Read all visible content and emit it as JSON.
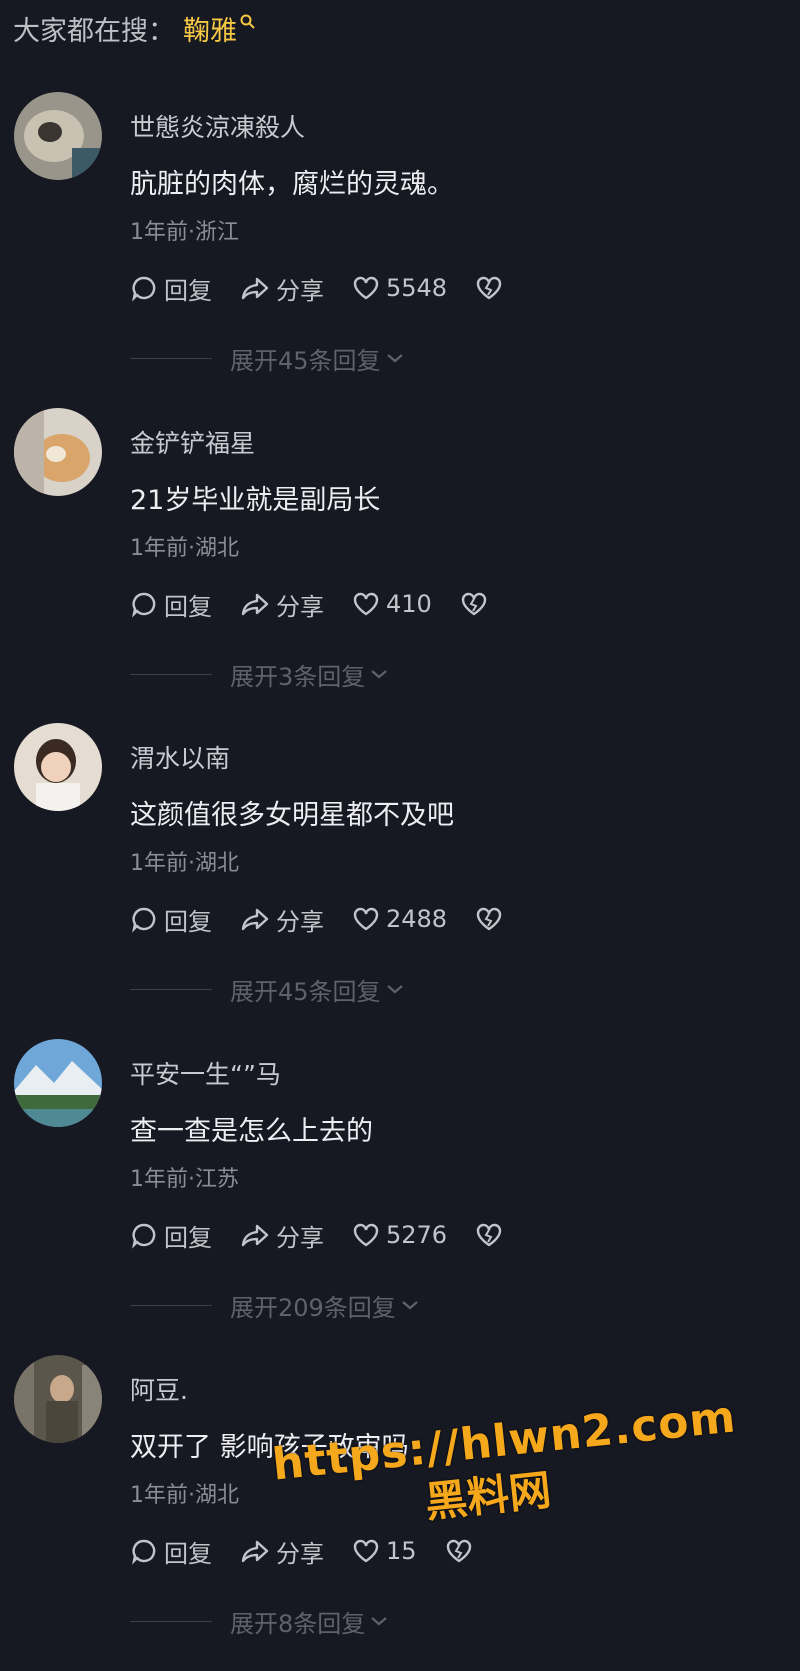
{
  "search": {
    "prefix": "大家都在搜：",
    "term": "鞠雅"
  },
  "comments": [
    {
      "username": "世態炎涼凍殺人",
      "text": "肮脏的肉体，腐烂的灵魂。",
      "meta": "1年前·浙江",
      "reply_label": "回复",
      "share_label": "分享",
      "likes": "5548",
      "expand_label": "展开45条回复"
    },
    {
      "username": "金铲铲福星",
      "text": "21岁毕业就是副局长",
      "meta": "1年前·湖北",
      "reply_label": "回复",
      "share_label": "分享",
      "likes": "410",
      "expand_label": "展开3条回复"
    },
    {
      "username": "渭水以南",
      "text": "这颜值很多女明星都不及吧",
      "meta": "1年前·湖北",
      "reply_label": "回复",
      "share_label": "分享",
      "likes": "2488",
      "expand_label": "展开45条回复"
    },
    {
      "username": "平安一生“”马",
      "text": "查一查是怎么上去的",
      "meta": "1年前·江苏",
      "reply_label": "回复",
      "share_label": "分享",
      "likes": "5276",
      "expand_label": "展开209条回复"
    },
    {
      "username": "阿豆.",
      "text": "双开了 影响孩子政审吗",
      "meta": "1年前·湖北",
      "reply_label": "回复",
      "share_label": "分享",
      "likes": "15",
      "expand_label": "展开8条回复"
    }
  ],
  "watermark": {
    "url": "https://hlwn2.com",
    "name": "黑料网"
  },
  "colors": {
    "background": "#161822",
    "search_term": "#f6c844",
    "watermark": "#f5a81c"
  }
}
